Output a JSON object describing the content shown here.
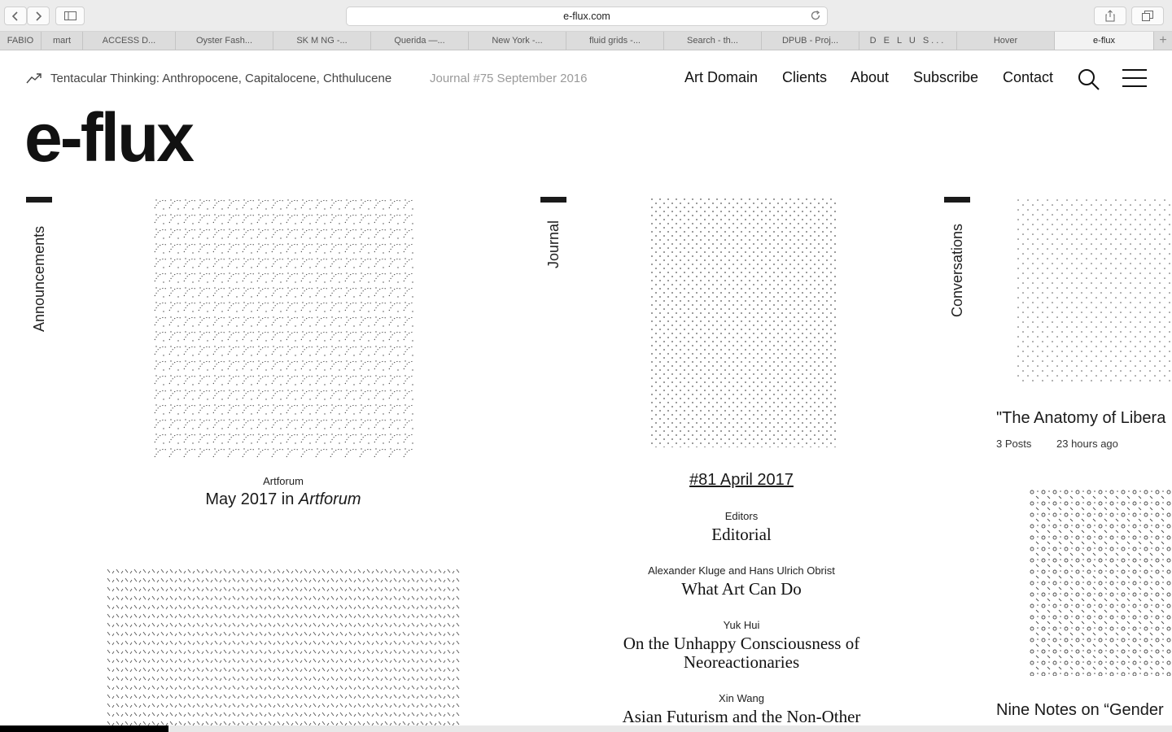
{
  "browser": {
    "url": "e-flux.com",
    "tabs": [
      "FABIO",
      "mart",
      "ACCESS D...",
      "Oyster Fash...",
      "SK M NG -...",
      "Querida —...",
      "New York -...",
      "fluid grids -...",
      "Search - th...",
      "DPUB - Proj...",
      "D E L U S...",
      "Hover",
      "e-flux"
    ],
    "new_tab_label": "+"
  },
  "topbar": {
    "current_title": "Tentacular Thinking: Anthropocene, Capitalocene, Chthulucene",
    "current_issue": "Journal #75 September 2016"
  },
  "nav": {
    "items": [
      "Art Domain",
      "Clients",
      "About",
      "Subscribe",
      "Contact"
    ]
  },
  "logo": "e-flux",
  "announcements": {
    "section_label": "Announcements",
    "item": {
      "source": "Artforum",
      "title_prefix": "May 2017 in ",
      "title_italic": "Artforum"
    }
  },
  "journal": {
    "section_label": "Journal",
    "issue": "#81 April 2017",
    "articles": [
      {
        "author": "Editors",
        "title": "Editorial"
      },
      {
        "author": "Alexander Kluge and Hans Ulrich Obrist",
        "title": "What Art Can Do"
      },
      {
        "author": "Yuk Hui",
        "title": "On the Unhappy Consciousness of Neoreactionaries"
      },
      {
        "author": "Xin Wang",
        "title": "Asian Futurism and the Non-Other"
      }
    ]
  },
  "conversations": {
    "section_label": "Conversations",
    "items": [
      {
        "title": "\"The Anatomy of Libera",
        "posts": "3 Posts",
        "time": "23 hours ago"
      },
      {
        "title": "Nine Notes on “Gender"
      }
    ]
  }
}
